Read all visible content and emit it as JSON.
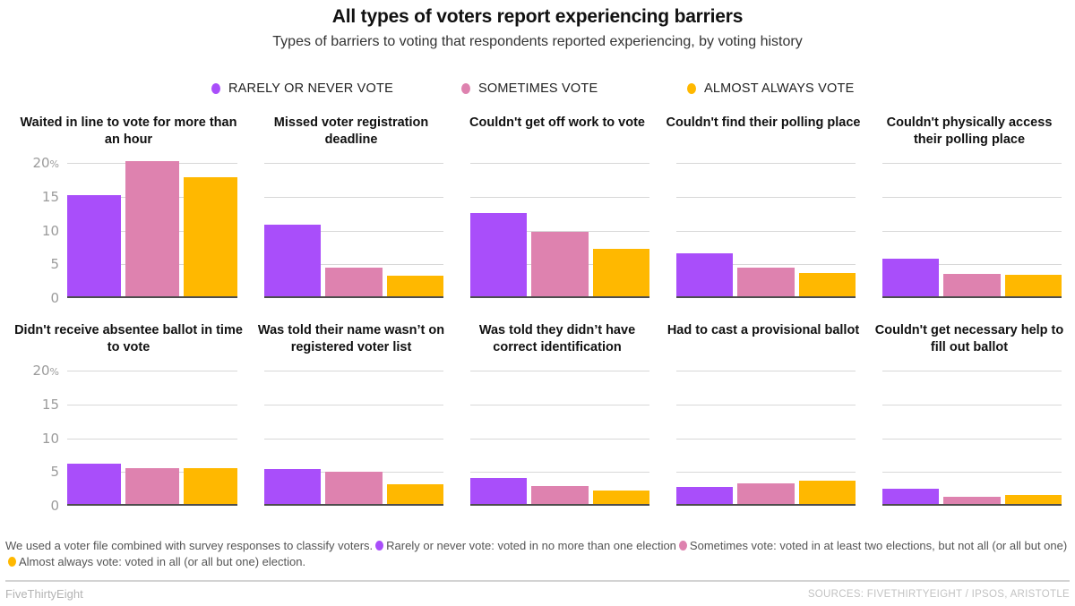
{
  "header": {
    "title": "All types of voters report experiencing barriers",
    "subtitle": "Types of barriers to voting that respondents reported experiencing, by voting history"
  },
  "legend": {
    "items": [
      {
        "label": "RARELY OR NEVER VOTE",
        "color": "#A94EFA"
      },
      {
        "label": "SOMETIMES VOTE",
        "color": "#DE82AF"
      },
      {
        "label": "ALMOST ALWAYS VOTE",
        "color": "#FFB800"
      }
    ]
  },
  "axis": {
    "ticks": [
      {
        "label": "20",
        "suffix": "%",
        "value": 20
      },
      {
        "label": "15",
        "suffix": "",
        "value": 15
      },
      {
        "label": "10",
        "suffix": "",
        "value": 10
      },
      {
        "label": "5",
        "suffix": "",
        "value": 5
      },
      {
        "label": "0",
        "suffix": "",
        "value": 0
      }
    ]
  },
  "footnote": {
    "part1": "We used a voter file combined with survey responses to classify voters.",
    "part2": "Rarely or never vote: voted in no more than one election",
    "part3": "Sometimes vote: voted in at least two elections, but not all (or all but one)",
    "part4": "Almost always vote: voted in all (or all but one) election."
  },
  "footer": {
    "brand": "FiveThirtyEight",
    "sources": "SOURCES: FIVETHIRTYEIGHT / IPSOS, ARISTOTLE"
  },
  "chart_data": {
    "type": "bar",
    "title": "All types of voters report experiencing barriers",
    "subtitle": "Types of barriers to voting that respondents reported experiencing, by voting history",
    "xlabel": "",
    "ylabel": "",
    "ylim": [
      0,
      20
    ],
    "yticks": [
      0,
      5,
      10,
      15,
      20
    ],
    "unit": "%",
    "grid": true,
    "legend_position": "top",
    "series_names": [
      "Rarely or never vote",
      "Sometimes vote",
      "Almost always vote"
    ],
    "series_colors": [
      "#A94EFA",
      "#DE82AF",
      "#FFB800"
    ],
    "panels": [
      {
        "title": "Waited in line to vote for more than an hour",
        "values": [
          15.0,
          20.0,
          17.6
        ]
      },
      {
        "title": "Missed voter registration deadline",
        "values": [
          10.6,
          4.3,
          3.0
        ]
      },
      {
        "title": "Couldn't get off work to vote",
        "values": [
          12.3,
          9.6,
          7.0
        ]
      },
      {
        "title": "Couldn't find their polling place",
        "values": [
          6.4,
          4.3,
          3.4
        ]
      },
      {
        "title": "Couldn't physically access their polling place",
        "values": [
          5.5,
          3.3,
          3.2
        ]
      },
      {
        "title": "Didn't receive absentee ballot in time to vote",
        "values": [
          6.0,
          5.3,
          5.3
        ]
      },
      {
        "title": "Was told their name wasn’t on registered voter list",
        "values": [
          5.2,
          4.8,
          2.9
        ]
      },
      {
        "title": "Was told they didn’t have correct identification",
        "values": [
          3.8,
          2.7,
          2.0
        ]
      },
      {
        "title": "Had to cast a provisional ballot",
        "values": [
          2.5,
          3.0,
          3.4
        ]
      },
      {
        "title": "Couldn't get necessary help to fill out ballot",
        "values": [
          2.3,
          1.1,
          1.3
        ]
      }
    ]
  }
}
